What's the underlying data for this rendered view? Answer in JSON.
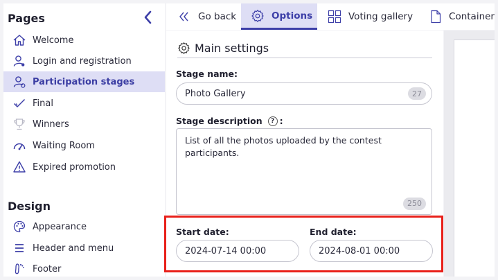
{
  "sidebar": {
    "pages_title": "Pages",
    "pages": [
      {
        "label": "Welcome",
        "icon": "home-icon",
        "active": false
      },
      {
        "label": "Login and registration",
        "icon": "user-gear-icon",
        "active": false
      },
      {
        "label": "Participation stages",
        "icon": "user-stages-icon",
        "active": true
      },
      {
        "label": "Final",
        "icon": "check-icon",
        "active": false
      },
      {
        "label": "Winners",
        "icon": "trophy-icon",
        "active": false
      },
      {
        "label": "Waiting Room",
        "icon": "gauge-icon",
        "active": false
      },
      {
        "label": "Expired promotion",
        "icon": "warning-icon",
        "active": false
      }
    ],
    "design_title": "Design",
    "design": [
      {
        "label": "Appearance",
        "icon": "palette-icon"
      },
      {
        "label": "Header and menu",
        "icon": "menu-icon"
      },
      {
        "label": "Footer",
        "icon": "footprint-icon"
      }
    ]
  },
  "tabs": [
    {
      "label": "Go back",
      "icon": "double-chevron-left-icon",
      "active": false
    },
    {
      "label": "Options",
      "icon": "gear-icon",
      "active": true
    },
    {
      "label": "Voting gallery",
      "icon": "grid-icon",
      "active": false
    },
    {
      "label": "Container",
      "icon": "document-icon",
      "active": false
    }
  ],
  "settings": {
    "title": "Main settings",
    "stage_name_label": "Stage name:",
    "stage_name_value": "Photo Gallery",
    "stage_name_count": "27",
    "stage_description_label": "Stage description",
    "stage_description_suffix": ":",
    "help_glyph": "?",
    "stage_description_value": "List of all the photos uploaded by the contest participants.",
    "stage_description_count": "250",
    "start_date_label": "Start date:",
    "start_date_value": "2024-07-14 00:00",
    "end_date_label": "End date:",
    "end_date_value": "2024-08-01 00:00"
  },
  "colors": {
    "accent": "#3d3fa8",
    "active_bg": "#dedef5",
    "highlight": "#e8201a"
  }
}
